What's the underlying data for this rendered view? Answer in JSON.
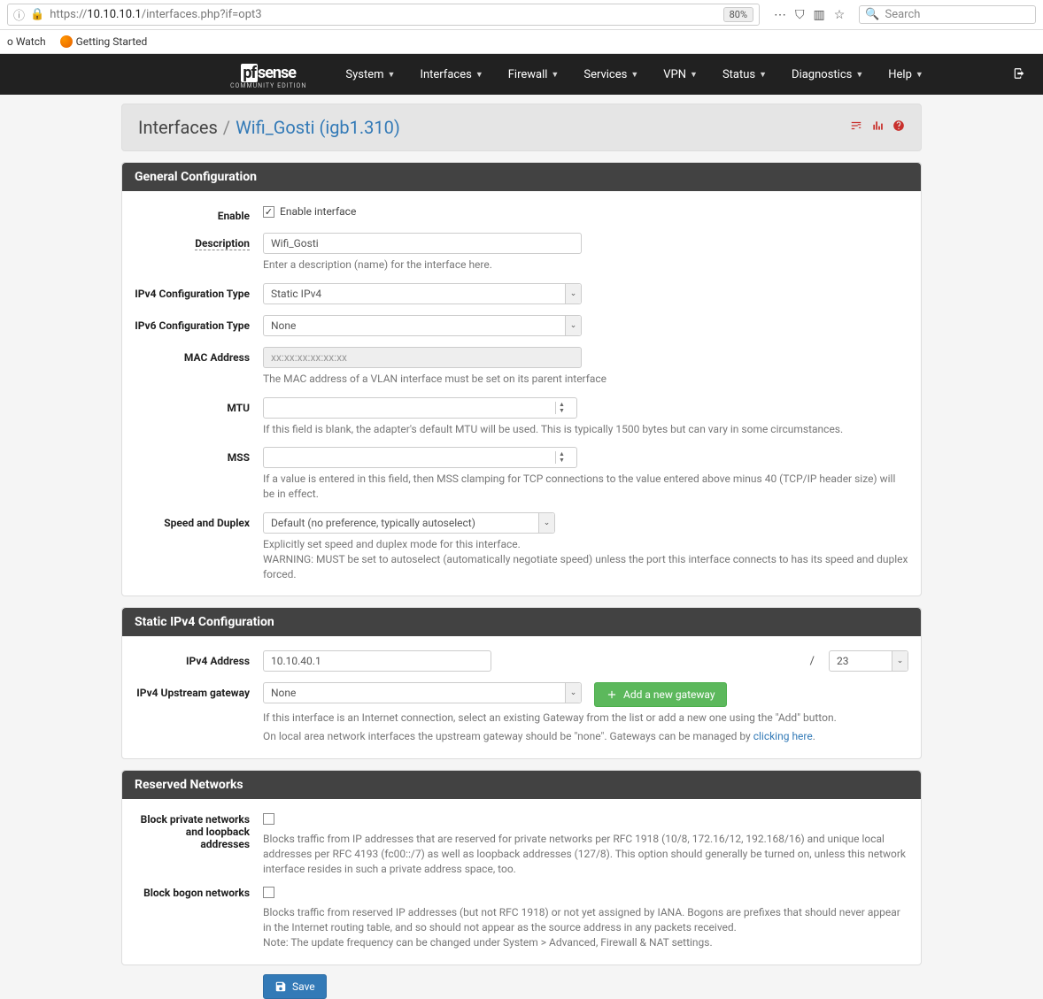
{
  "browser": {
    "url_prefix": "https://",
    "url_domain": "10.10.10.1",
    "url_path": "/interfaces.php?if=opt3",
    "zoom": "80%",
    "search_placeholder": "Search",
    "bookmarks": [
      "o Watch",
      "Getting Started"
    ]
  },
  "logo": {
    "brand": "sense",
    "pf": "pf",
    "edition": "COMMUNITY EDITION"
  },
  "nav": [
    "System",
    "Interfaces",
    "Firewall",
    "Services",
    "VPN",
    "Status",
    "Diagnostics",
    "Help"
  ],
  "breadcrumb": {
    "root": "Interfaces",
    "current": "Wifi_Gosti (igb1.310)"
  },
  "panels": {
    "general": {
      "title": "General Configuration",
      "enable_label": "Enable",
      "enable_text": "Enable interface",
      "enable_checked": true,
      "desc_label": "Description",
      "desc_value": "Wifi_Gosti",
      "desc_help": "Enter a description (name) for the interface here.",
      "ipv4type_label": "IPv4 Configuration Type",
      "ipv4type_value": "Static IPv4",
      "ipv6type_label": "IPv6 Configuration Type",
      "ipv6type_value": "None",
      "mac_label": "MAC Address",
      "mac_placeholder": "xx:xx:xx:xx:xx:xx",
      "mac_help": "The MAC address of a VLAN interface must be set on its parent interface",
      "mtu_label": "MTU",
      "mtu_help": "If this field is blank, the adapter's default MTU will be used. This is typically 1500 bytes but can vary in some circumstances.",
      "mss_label": "MSS",
      "mss_help": "If a value is entered in this field, then MSS clamping for TCP connections to the value entered above minus 40 (TCP/IP header size) will be in effect.",
      "speed_label": "Speed and Duplex",
      "speed_value": "Default (no preference, typically autoselect)",
      "speed_help": "Explicitly set speed and duplex mode for this interface.\nWARNING: MUST be set to autoselect (automatically negotiate speed) unless the port this interface connects to has its speed and duplex forced."
    },
    "ipv4": {
      "title": "Static IPv4 Configuration",
      "addr_label": "IPv4 Address",
      "addr_value": "10.10.40.1",
      "cidr_slash": "/",
      "cidr_value": "23",
      "gw_label": "IPv4 Upstream gateway",
      "gw_value": "None",
      "gw_add": "Add a new gateway",
      "gw_help1": "If this interface is an Internet connection, select an existing Gateway from the list or add a new one using the \"Add\" button.",
      "gw_help2_a": "On local area network interfaces the upstream gateway should be \"none\". Gateways can be managed by ",
      "gw_help2_link": "clicking here",
      "gw_help2_b": "."
    },
    "reserved": {
      "title": "Reserved Networks",
      "priv_label": "Block private networks and loopback addresses",
      "priv_help": "Blocks traffic from IP addresses that are reserved for private networks per RFC 1918 (10/8, 172.16/12, 192.168/16) and unique local addresses per RFC 4193 (fc00::/7) as well as loopback addresses (127/8). This option should generally be turned on, unless this network interface resides in such a private address space, too.",
      "bogon_label": "Block bogon networks",
      "bogon_help": "Blocks traffic from reserved IP addresses (but not RFC 1918) or not yet assigned by IANA. Bogons are prefixes that should never appear in the Internet routing table, and so should not appear as the source address in any packets received.\nNote: The update frequency can be changed under System > Advanced, Firewall & NAT settings."
    }
  },
  "save": "Save"
}
